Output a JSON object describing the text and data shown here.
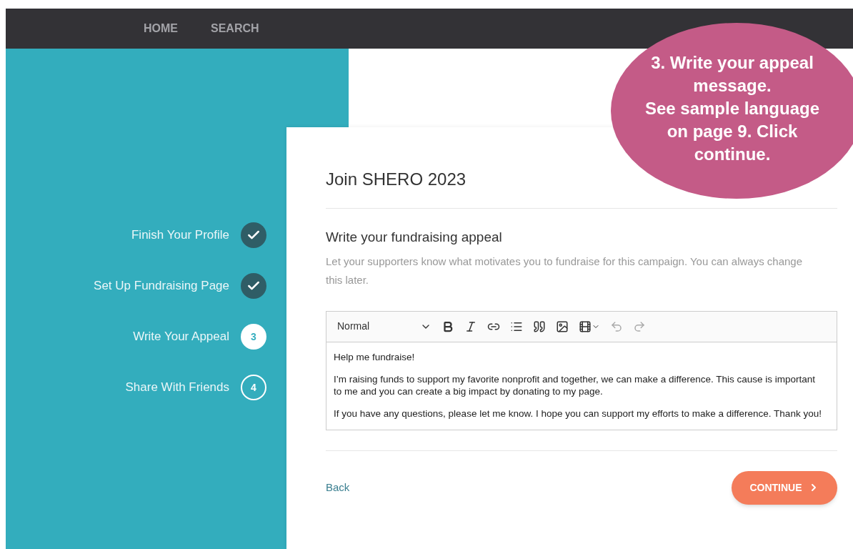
{
  "nav": {
    "items": [
      "HOME",
      "SEARCH"
    ]
  },
  "steps": [
    {
      "label": "Finish Your Profile",
      "kind": "done"
    },
    {
      "label": "Set Up Fundraising Page",
      "kind": "done"
    },
    {
      "label": "Write Your Appeal",
      "kind": "current",
      "number": "3"
    },
    {
      "label": "Share With Friends",
      "kind": "todo",
      "number": "4"
    }
  ],
  "card": {
    "title": "Join SHERO 2023",
    "heading": "Write your fundraising appeal",
    "description": "Let your supporters know what motivates you to fundraise for this campaign. You can always change this later.",
    "editor": {
      "format": "Normal",
      "paragraphs": [
        "Help me fundraise!",
        "I’m raising funds to support my favorite nonprofit and together, we can make a difference. This cause is important to me and you can create a big impact by donating to my page.",
        "If you have any questions, please let me know. I hope you can support my efforts to make a difference. Thank you!"
      ]
    },
    "back": "Back",
    "continue": "CONTINUE"
  },
  "callout": {
    "lines": [
      "3. Write your appeal message.",
      "See sample language on page 9. Click continue."
    ]
  }
}
